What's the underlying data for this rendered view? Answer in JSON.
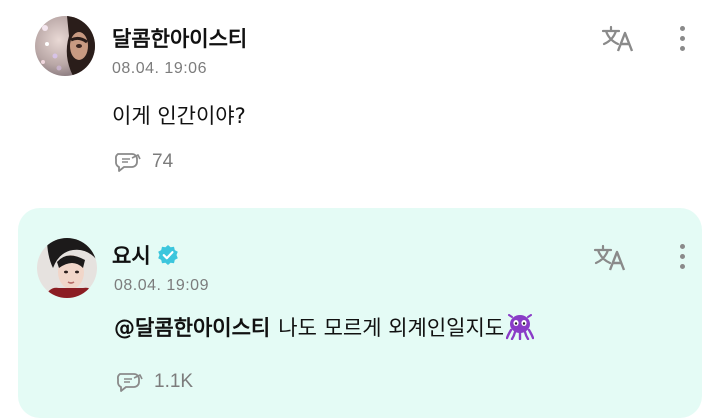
{
  "posts": [
    {
      "author": "달콤한아이스티",
      "timestamp": "08.04. 19:06",
      "text": "이게 인간이야?",
      "reply_count": "74",
      "verified": false
    },
    {
      "author": "요시",
      "timestamp": "08.04. 19:09",
      "mention": "@달콤한아이스티",
      "text": "나도 모르게 외계인일지도",
      "emoji": "alien-monster-emoji",
      "reply_count": "1.1K",
      "verified": true,
      "highlighted": true
    }
  ],
  "colors": {
    "highlight_bg": "#e4fbf5",
    "verified_badge": "#3cc6dd",
    "meta_text": "#7c7c7c",
    "emoji_purple": "#8a3cc7"
  },
  "icons": [
    "translate-icon",
    "more-vertical-icon",
    "reply-bubble-icon",
    "verified-badge-icon"
  ]
}
